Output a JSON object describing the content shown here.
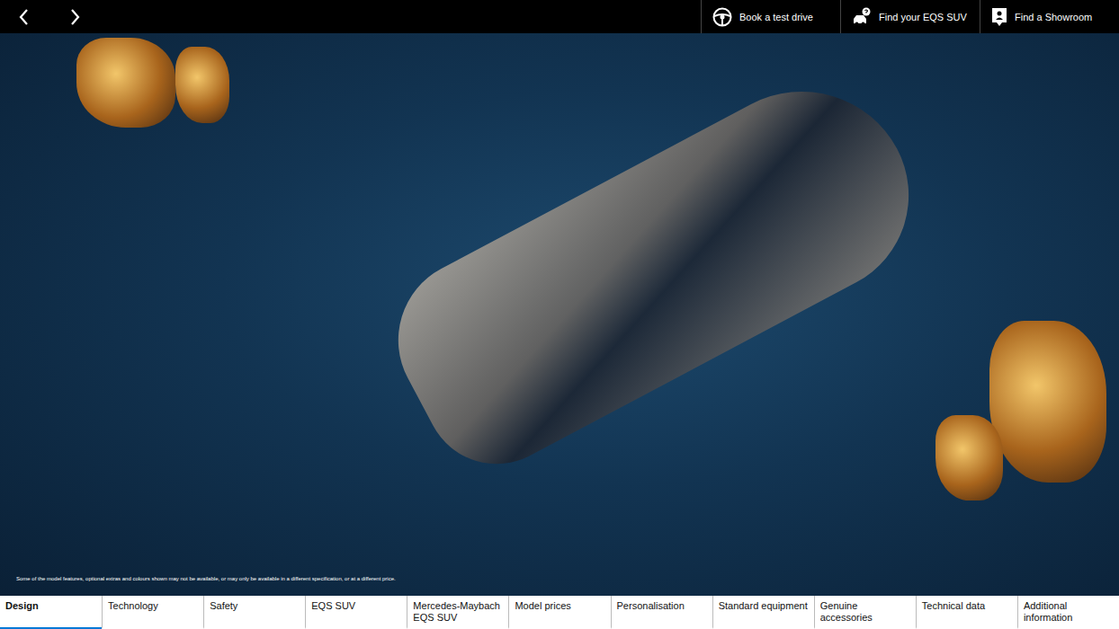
{
  "top_bar": {
    "actions": [
      {
        "label": "Book a test drive",
        "icon": "steering-wheel"
      },
      {
        "label": "Find your EQS SUV",
        "icon": "car-search"
      },
      {
        "label": "Find a Showroom",
        "icon": "showroom-pin"
      }
    ]
  },
  "hero": {
    "disclaimer": "Some of the model features, optional extras and colours shown may not be available, or may only be available in a different specification, or at a different price."
  },
  "nav_tabs": [
    {
      "label": "Design",
      "selected": true
    },
    {
      "label": "Technology",
      "selected": false
    },
    {
      "label": "Safety",
      "selected": false
    },
    {
      "label": "EQS SUV",
      "selected": false
    },
    {
      "label": "Mercedes-Maybach EQS SUV",
      "selected": false
    },
    {
      "label": "Model prices",
      "selected": false
    },
    {
      "label": "Personalisation",
      "selected": false
    },
    {
      "label": "Standard equipment",
      "selected": false
    },
    {
      "label": "Genuine accessories",
      "selected": false
    },
    {
      "label": "Technical data",
      "selected": false
    },
    {
      "label": "Additional information",
      "selected": false
    }
  ]
}
